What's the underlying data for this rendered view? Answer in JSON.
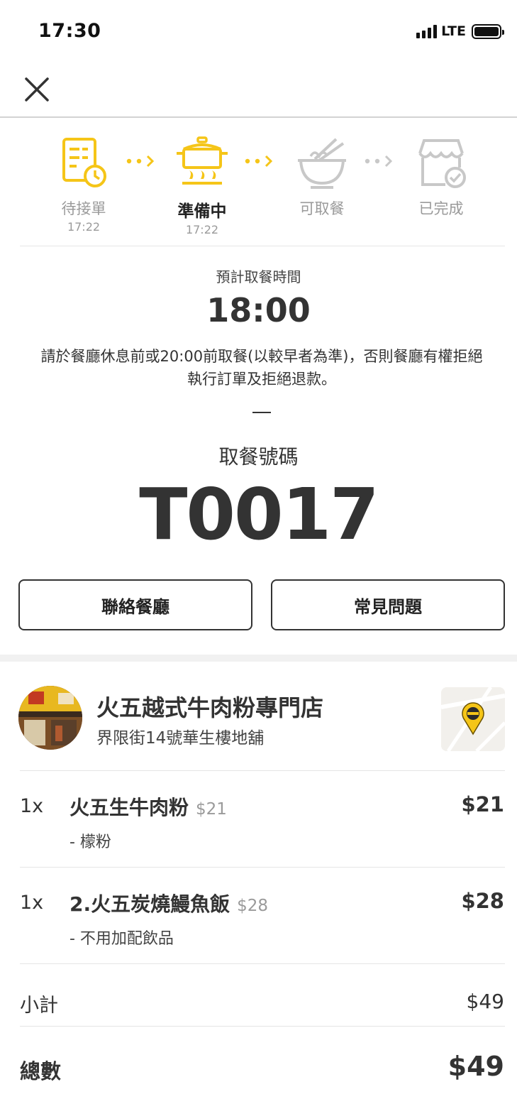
{
  "status_bar": {
    "time": "17:30",
    "network": "LTE"
  },
  "progress": {
    "steps": [
      {
        "label": "待接單",
        "time": "17:22",
        "state": "done",
        "icon": "order-clock-icon"
      },
      {
        "label": "準備中",
        "time": "17:22",
        "state": "active",
        "icon": "cooking-pot-icon"
      },
      {
        "label": "可取餐",
        "time": "",
        "state": "pending",
        "icon": "noodle-bowl-icon"
      },
      {
        "label": "已完成",
        "time": "",
        "state": "pending",
        "icon": "store-check-icon"
      }
    ],
    "active_color": "#F5C518",
    "inactive_color": "#C8C8C8"
  },
  "pickup": {
    "caption": "預計取餐時間",
    "time": "18:00",
    "notice_line1": "請於餐廳休息前或20:00前取餐(以較早者為準)，否則餐廳有權拒絕",
    "notice_line2": "執行訂單及拒絕退款。",
    "code_caption": "取餐號碼",
    "code": "T0017"
  },
  "actions": {
    "contact_label": "聯絡餐廳",
    "faq_label": "常見問題"
  },
  "restaurant": {
    "name": "火五越式牛肉粉專門店",
    "address": "界限街14號華生樓地舖"
  },
  "order": {
    "items": [
      {
        "qty": "1x",
        "name": "火五生牛肉粉",
        "unit_price": "$21",
        "option": "- 檬粉",
        "price": "$21"
      },
      {
        "qty": "1x",
        "name": "2.火五炭燒鰻魚飯",
        "unit_price": "$28",
        "option": "- 不用加配飲品",
        "price": "$28"
      }
    ],
    "subtotal_label": "小計",
    "subtotal": "$49",
    "total_label": "總數",
    "total": "$49"
  }
}
